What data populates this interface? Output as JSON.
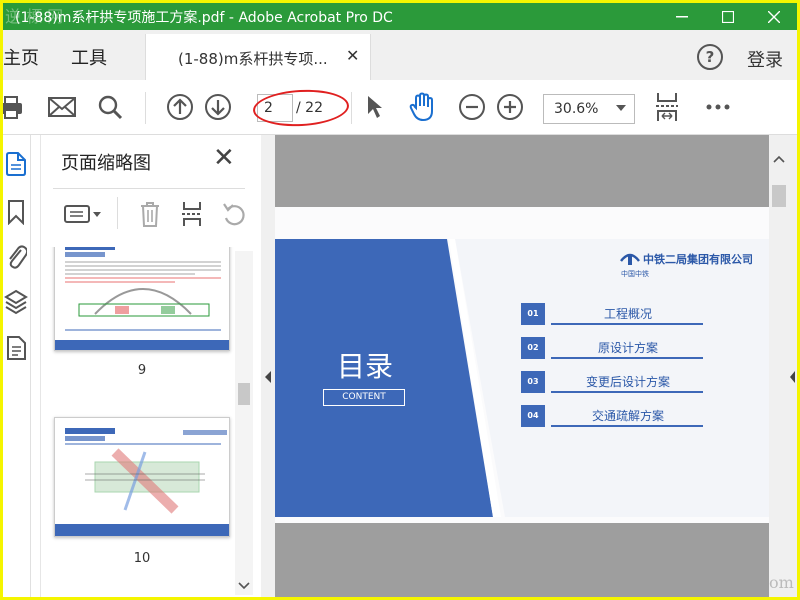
{
  "window": {
    "title": "(1-88)m系杆拱专项施工方案.pdf - Adobe Acrobat Pro DC",
    "watermark": "逆 標 网"
  },
  "tabs": {
    "home": "主页",
    "tools": "工具",
    "document": "(1-88)m系杆拱专项...",
    "login": "登录"
  },
  "toolbar": {
    "current_page": "2",
    "total_pages": "/ 22",
    "zoom": "30.6%"
  },
  "thumbnail_panel": {
    "title": "页面缩略图",
    "pages": [
      {
        "number": "9",
        "header": "4 施工方案设计",
        "footer": "中铁二局第二工程有限公司"
      },
      {
        "number": "10",
        "header": "4 施工方案设计",
        "footer": "中铁二局第二工程有限公司"
      }
    ]
  },
  "document": {
    "heading": "目录",
    "subheading": "CONTENT",
    "company": "中铁二局集团有限公司",
    "company_sub": "中国中铁",
    "toc": [
      {
        "num": "01",
        "text": "工程概况"
      },
      {
        "num": "02",
        "text": "原设计方案"
      },
      {
        "num": "03",
        "text": "变更后设计方案"
      },
      {
        "num": "04",
        "text": "交通疏解方案"
      }
    ],
    "footer_text": "om"
  },
  "colors": {
    "titlebar": "#2b9a3a",
    "accent_blue": "#3d68b8",
    "highlight_red": "#e02020",
    "outer_border": "#f5f500"
  }
}
